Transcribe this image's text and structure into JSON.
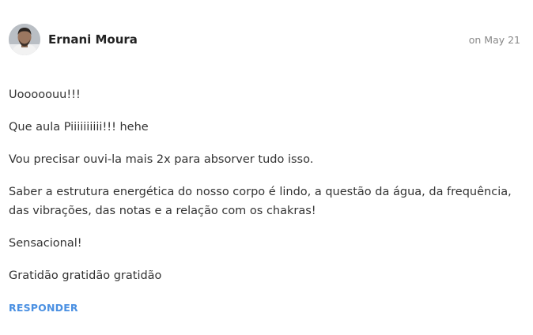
{
  "comment": {
    "author": "Ernani Moura",
    "date": "on May 21",
    "avatar_icon": "user-avatar-photo",
    "paragraphs": [
      "Uooooouu!!!",
      "Que aula Piiiiiiiiii!!! hehe",
      "Vou precisar ouvi-la mais 2x para absorver tudo isso.",
      "Saber a estrutura energética do nosso corpo é lindo, a questão da água, da frequência, das vibrações, das notas e a relação com os chakras!",
      "Sensacional!",
      "Gratidão gratidão gratidão"
    ],
    "reply_label": "RESPONDER"
  },
  "colors": {
    "accent": "#4a90e2",
    "text": "#333333",
    "muted": "#888888"
  }
}
